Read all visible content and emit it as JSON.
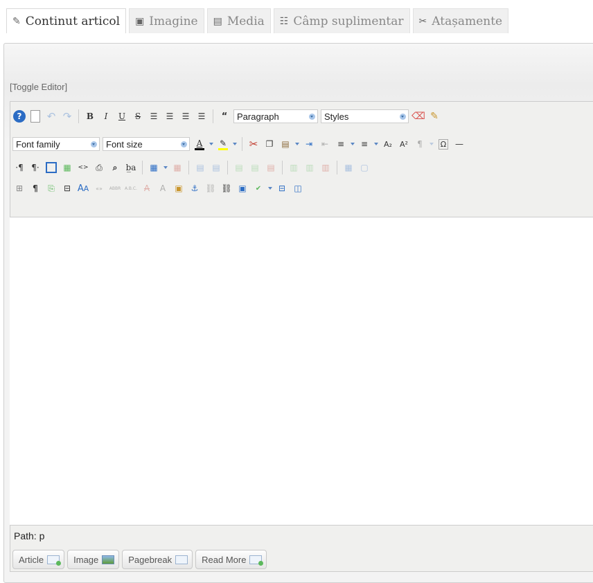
{
  "tabs": [
    {
      "label": "Continut articol",
      "icon": "edit-icon",
      "glyph": "✎"
    },
    {
      "label": "Imagine",
      "icon": "image-icon",
      "glyph": "▣"
    },
    {
      "label": "Media",
      "icon": "film-icon",
      "glyph": "▤"
    },
    {
      "label": "Câmp suplimentar",
      "icon": "binoculars-icon",
      "glyph": "☷"
    },
    {
      "label": "Atașamente",
      "icon": "paperclip-icon",
      "glyph": "✂"
    }
  ],
  "editor": {
    "toggle_label": "[Toggle Editor]",
    "format_select": "Paragraph",
    "styles_select": "Styles",
    "font_family_select": "Font family",
    "font_size_select": "Font size",
    "path_label": "Path:",
    "path_value": "p"
  },
  "extra_buttons": [
    {
      "label": "Article"
    },
    {
      "label": "Image"
    },
    {
      "label": "Pagebreak"
    },
    {
      "label": "Read More"
    }
  ],
  "colors": {
    "accent": "#3a6ea5",
    "font_color_bar": "#000000",
    "highlight_bar": "#ffff00"
  }
}
